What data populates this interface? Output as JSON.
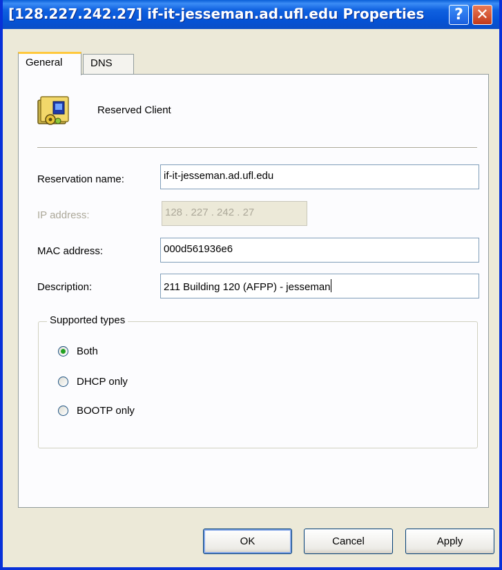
{
  "window": {
    "title": "[128.227.242.27] if-it-jesseman.ad.ufl.edu Properties",
    "help_glyph": "?",
    "close_glyph": "✕"
  },
  "tabs": [
    {
      "label": "General",
      "active": true
    },
    {
      "label": "DNS",
      "active": false
    }
  ],
  "general": {
    "client_icon": "reserved-client-icon",
    "client_label": "Reserved Client",
    "fields": {
      "reservation_name": {
        "label": "Reservation name:",
        "value": "if-it-jesseman.ad.ufl.edu"
      },
      "ip_address": {
        "label": "IP address:",
        "value": "128 . 227 . 242 .  27",
        "disabled": true
      },
      "mac_address": {
        "label": "MAC address:",
        "value": "000d561936e6"
      },
      "description": {
        "label": "Description:",
        "value": "211 Building 120 (AFPP) - jesseman"
      }
    },
    "supported_types": {
      "title": "Supported types",
      "options": [
        {
          "label": "Both",
          "selected": true
        },
        {
          "label": "DHCP only",
          "selected": false
        },
        {
          "label": "BOOTP only",
          "selected": false
        }
      ]
    }
  },
  "buttons": {
    "ok": "OK",
    "cancel": "Cancel",
    "apply": "Apply"
  },
  "colors": {
    "titlebar": "#0553d6",
    "dialog_bg": "#ece9d8",
    "active_tab_accent": "#ffc83c",
    "radio_dot": "#21a121"
  }
}
